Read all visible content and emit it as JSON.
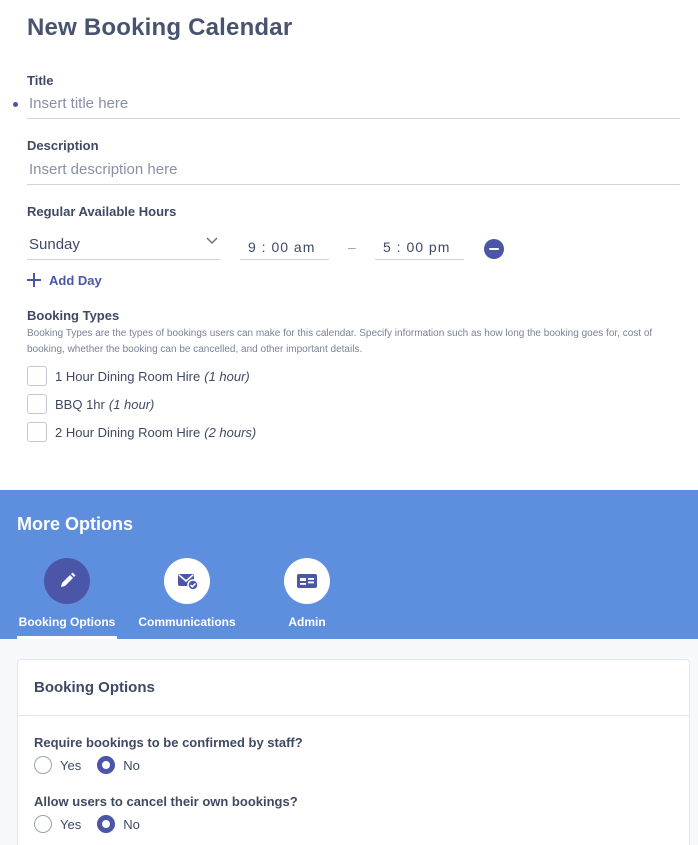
{
  "page": {
    "title": "New Booking Calendar"
  },
  "form": {
    "title_label": "Title",
    "title_placeholder": "Insert title here",
    "description_label": "Description",
    "description_placeholder": "Insert description here",
    "hours_label": "Regular Available Hours",
    "hours": {
      "day": "Sunday",
      "start": "9 : 00  am",
      "separator": "–",
      "end": "5 : 00  pm"
    },
    "add_day_label": "Add Day",
    "booking_types_label": "Booking Types",
    "booking_types_desc": "Booking Types are the types of bookings users can make for this calendar. Specify information such as how long the booking goes for, cost of booking, whether the booking can be cancelled, and other important details.",
    "booking_types": [
      {
        "name": "1 Hour Dining Room Hire",
        "duration": "(1 hour)",
        "checked": false
      },
      {
        "name": "BBQ 1hr",
        "duration": "(1 hour)",
        "checked": false
      },
      {
        "name": "2 Hour Dining Room Hire",
        "duration": "(2 hours)",
        "checked": false
      }
    ]
  },
  "more_options": {
    "title": "More Options",
    "tabs": [
      {
        "label": "Booking Options",
        "icon": "pencil-icon",
        "active": true
      },
      {
        "label": "Communications",
        "icon": "mail-check-icon",
        "active": false
      },
      {
        "label": "Admin",
        "icon": "id-card-icon",
        "active": false
      }
    ]
  },
  "booking_options": {
    "title": "Booking Options",
    "questions": [
      {
        "label": "Require bookings to be confirmed by staff?",
        "options": [
          "Yes",
          "No"
        ],
        "selected": "No"
      },
      {
        "label": "Allow users to cancel their own bookings?",
        "options": [
          "Yes",
          "No"
        ],
        "selected": "No"
      }
    ]
  },
  "colors": {
    "accent": "#4b56a8",
    "banner": "#5e8fde",
    "text": "#3e4a63"
  }
}
